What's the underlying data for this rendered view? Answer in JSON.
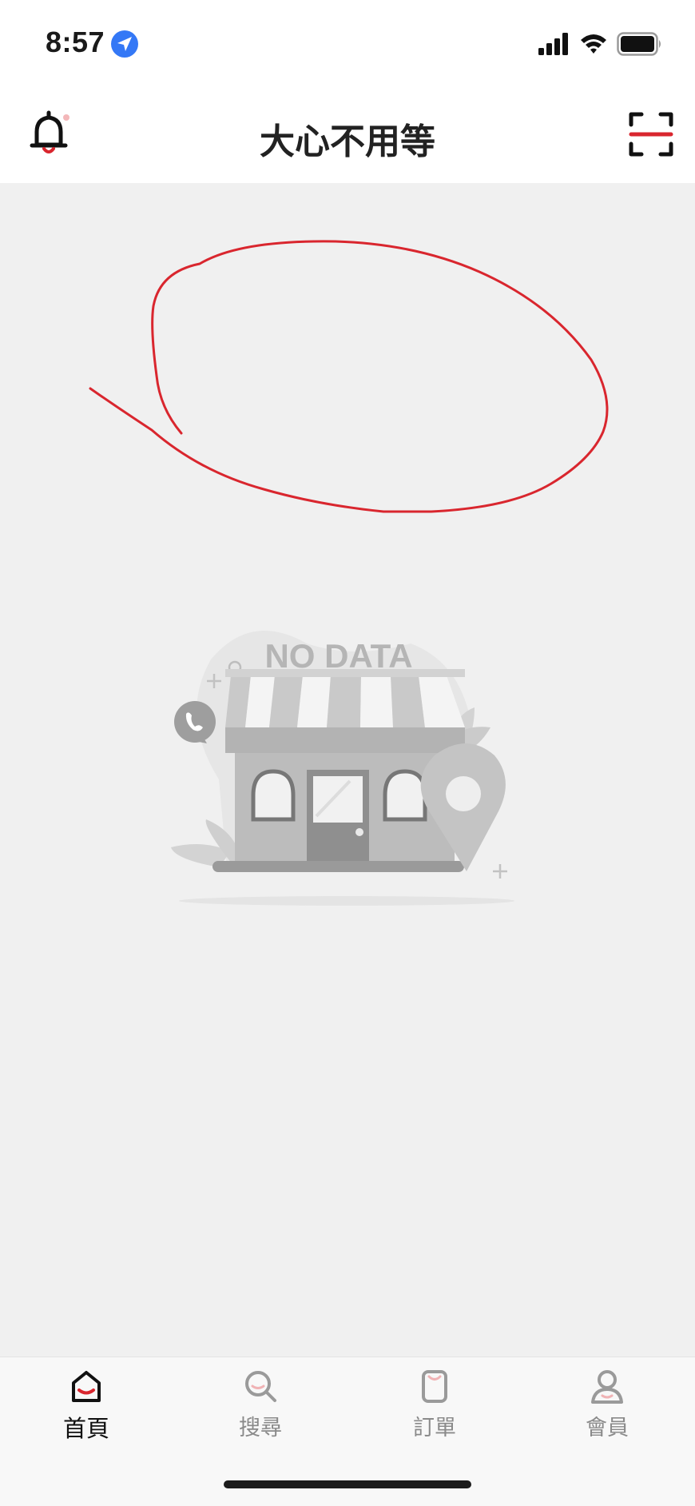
{
  "status_bar": {
    "time": "8:57",
    "icons": [
      "location-arrow-icon",
      "cellular-signal-icon",
      "wifi-icon",
      "battery-icon"
    ]
  },
  "header": {
    "title": "大心不用等",
    "left_icon": "bell-icon",
    "right_icon": "scan-icon"
  },
  "empty_state": {
    "illustration_text": "NO DATA",
    "illustration": "storefront-icon"
  },
  "annotation": {
    "color": "#d9262e",
    "shape": "hand-drawn circle"
  },
  "tabs": [
    {
      "label": "首頁",
      "icon": "home-icon",
      "active": true
    },
    {
      "label": "搜尋",
      "icon": "search-icon",
      "active": false
    },
    {
      "label": "訂單",
      "icon": "orders-bag-icon",
      "active": false
    },
    {
      "label": "會員",
      "icon": "member-icon",
      "active": false
    }
  ],
  "colors": {
    "accent": "#d9262e",
    "background": "#f0f0f0",
    "bar": "#ffffff",
    "tab_active": "#111111",
    "tab_inactive": "#8a8a8a"
  }
}
